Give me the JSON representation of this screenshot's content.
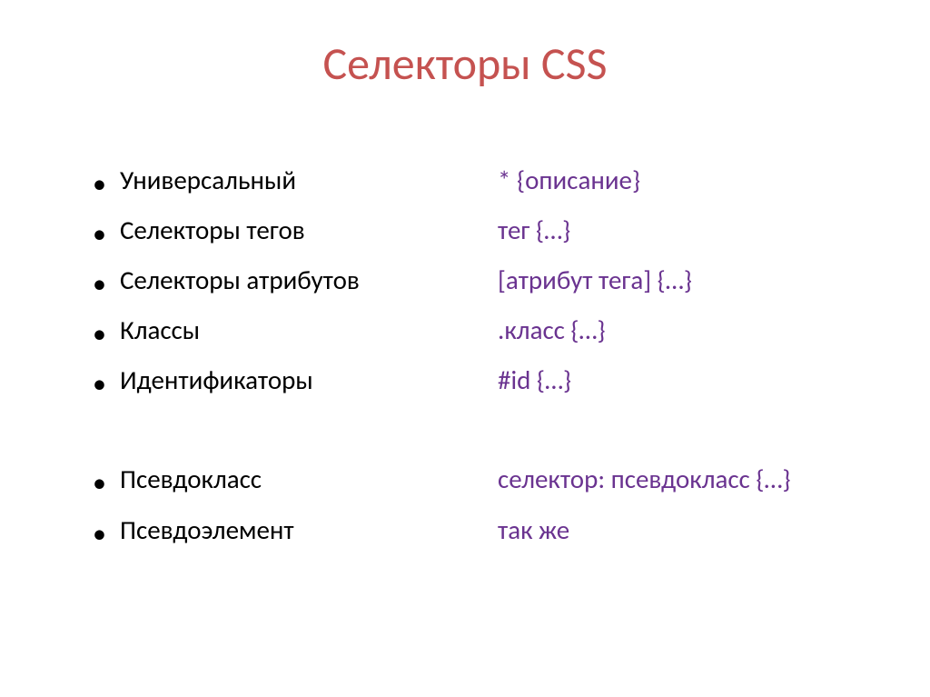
{
  "title": "Селекторы CSS",
  "leftColumn": {
    "group1": [
      "Универсальный",
      "Селекторы тегов",
      "Селекторы атрибутов",
      "Классы",
      "Идентификаторы"
    ],
    "group2": [
      "Псевдокласс",
      "Псевдоэлемент"
    ]
  },
  "rightColumn": {
    "group1": [
      "* {описание}",
      "тег {…}",
      "[атрибут тега] {…}",
      ".класс {…}",
      "#id {…}"
    ],
    "group2": [
      "селектор: псевдокласс {…}",
      "так же"
    ]
  }
}
